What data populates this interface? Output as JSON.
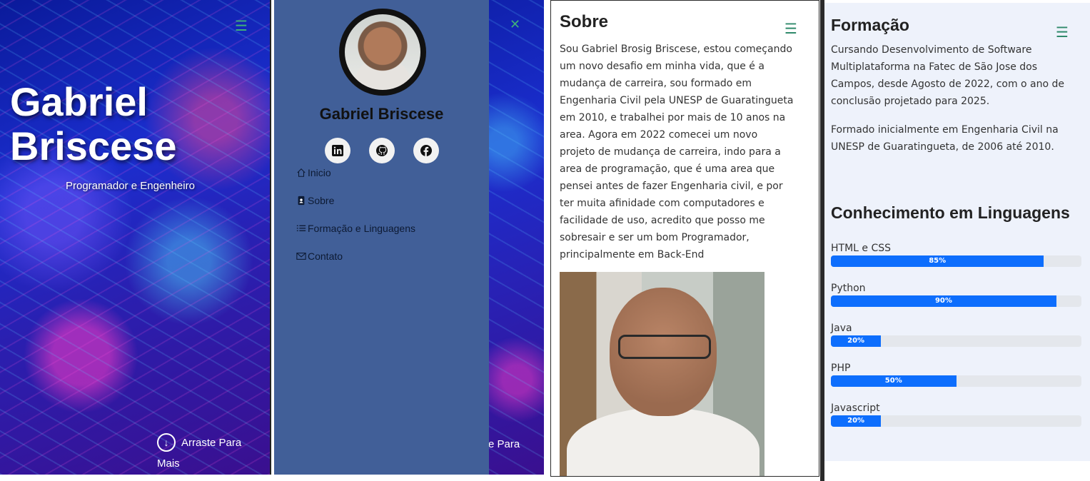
{
  "hero": {
    "name_line1": "Gabriel",
    "name_line2": "Briscese",
    "subtitle": "Programador e Engenheiro",
    "scroll_line1": "Arraste Para",
    "scroll_line2": "Mais",
    "menu_icon": "hamburger-icon"
  },
  "menu": {
    "name": "Gabriel Briscese",
    "close_icon": "close-icon",
    "peek_text": "e Para",
    "socials": [
      {
        "icon": "linkedin-icon"
      },
      {
        "icon": "github-icon"
      },
      {
        "icon": "facebook-icon"
      }
    ],
    "items": [
      {
        "label": "Inicio",
        "icon": "home-icon"
      },
      {
        "label": "Sobre",
        "icon": "person-badge-icon"
      },
      {
        "label": "Formação e Linguagens",
        "icon": "list-icon"
      },
      {
        "label": "Contato",
        "icon": "envelope-icon"
      }
    ],
    "bg_color": "#415f98"
  },
  "sobre": {
    "title": "Sobre",
    "text": "Sou Gabriel Brosig Briscese, estou começando um novo desafio em minha vida, que é a mudança de carreira, sou formado em Engenharia Civil pela UNESP de Guaratingueta em 2010, e trabalhei por mais de 10 anos na area. Agora em 2022 comecei um novo projeto de mudança de carreira, indo para a area de programação, que é uma area que pensei antes de fazer Engenharia civil, e por ter muita afinidade com computadores e facilidade de uso, acredito que posso me sobresair e ser um bom Programador, principalmente em Back-End"
  },
  "formacao": {
    "title": "Formação",
    "p1": "Cursando Desenvolvimento de Software Multiplataforma na Fatec de São Jose dos Campos, desde Agosto de 2022, com o ano de conclusão projetado para 2025.",
    "p2": "Formado inicialmente em Engenharia Civil na UNESP de Guaratingueta, de 2006 até 2010.",
    "skills_title": "Conhecimento em Linguagens",
    "skills": [
      {
        "name": "HTML e CSS",
        "percent": 85,
        "label": "85%"
      },
      {
        "name": "Python",
        "percent": 90,
        "label": "90%"
      },
      {
        "name": "Java",
        "percent": 20,
        "label": "20%"
      },
      {
        "name": "PHP",
        "percent": 50,
        "label": "50%"
      },
      {
        "name": "Javascript",
        "percent": 20,
        "label": "20%"
      }
    ],
    "accent_color": "#0d6efd"
  }
}
